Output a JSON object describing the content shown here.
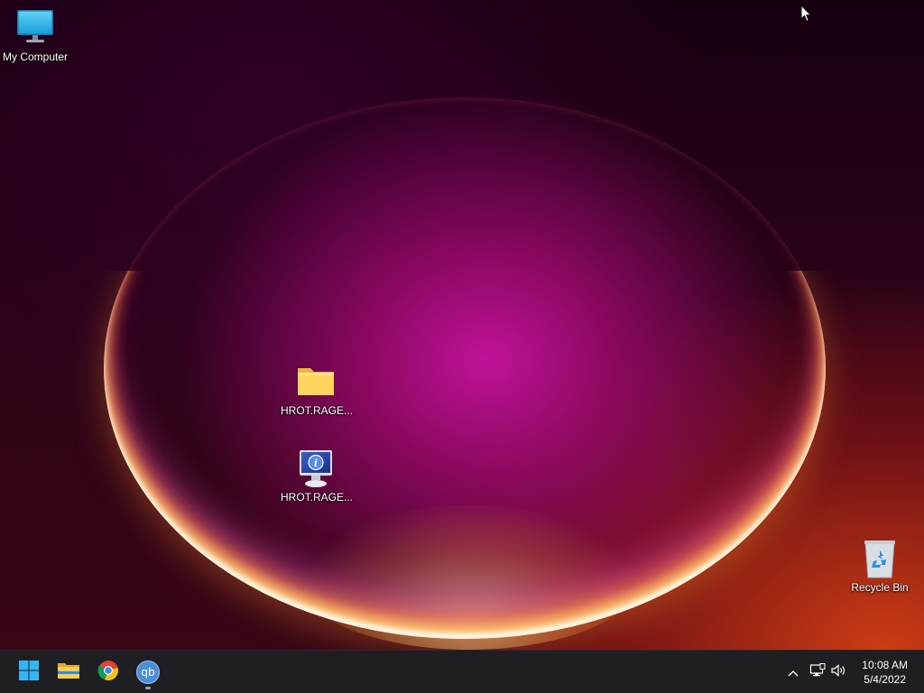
{
  "desktop": {
    "icons": [
      {
        "label": "My Computer",
        "icon": "monitor-icon"
      },
      {
        "label": "HROT.RAGE...",
        "icon": "folder-icon"
      },
      {
        "label": "HROT.RAGE...",
        "icon": "info-monitor-icon"
      },
      {
        "label": "Recycle Bin",
        "icon": "recycle-bin-icon"
      }
    ]
  },
  "taskbar": {
    "pinned": [
      {
        "name": "Start",
        "icon": "windows-logo-icon"
      },
      {
        "name": "File Explorer",
        "icon": "folder-icon"
      },
      {
        "name": "Google Chrome",
        "icon": "chrome-icon"
      },
      {
        "name": "qBittorrent",
        "icon": "qbittorrent-icon",
        "label": "qb"
      }
    ],
    "tray": {
      "icons": [
        "chevron-up-icon",
        "network-icon",
        "volume-icon"
      ],
      "time": "10:08 AM",
      "date": "5/4/2022"
    }
  },
  "colors": {
    "taskbar_bg": "#1f1f23",
    "accent_blue": "#0a84ff"
  }
}
